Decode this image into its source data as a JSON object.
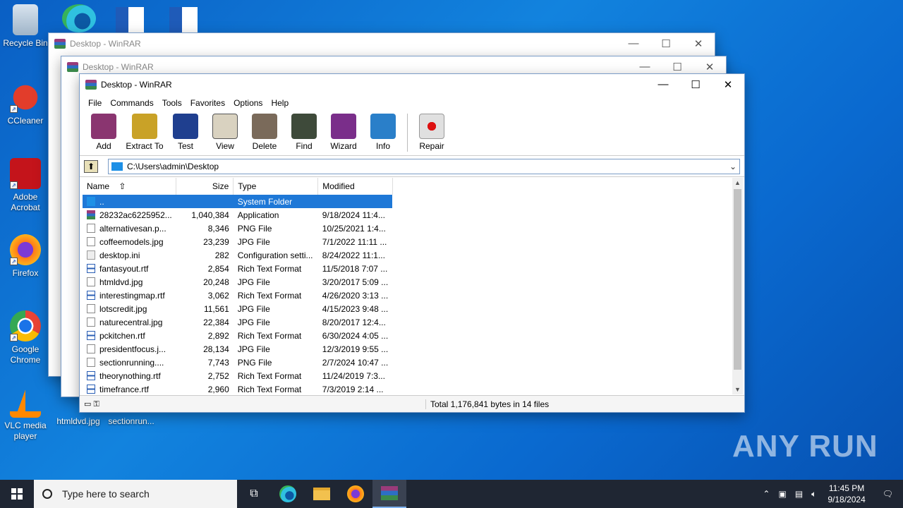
{
  "desktop": {
    "icons": [
      {
        "label": "Recycle Bin"
      },
      {
        "label": "CCleaner"
      },
      {
        "label": "Adobe Acrobat"
      },
      {
        "label": "Firefox"
      },
      {
        "label": "Google Chrome"
      },
      {
        "label": "VLC media player"
      },
      {
        "label": "htmldvd.jpg"
      },
      {
        "label": "sectionrun..."
      }
    ]
  },
  "back_windows": [
    {
      "title": "Desktop - WinRAR"
    },
    {
      "title": "Desktop - WinRAR"
    }
  ],
  "window": {
    "title": "Desktop - WinRAR",
    "controls": {
      "minimize": "—",
      "maximize": "☐",
      "close": "✕"
    },
    "menu": [
      "File",
      "Commands",
      "Tools",
      "Favorites",
      "Options",
      "Help"
    ],
    "toolbar": [
      {
        "label": "Add",
        "icon": "add-icon",
        "color": "#8a3570"
      },
      {
        "label": "Extract To",
        "icon": "extract-icon",
        "color": "#c9a227"
      },
      {
        "label": "Test",
        "icon": "test-icon",
        "color": "#1f3f8f"
      },
      {
        "label": "View",
        "icon": "view-icon",
        "color": "#d9d2c0"
      },
      {
        "label": "Delete",
        "icon": "delete-icon",
        "color": "#7a6a5a"
      },
      {
        "label": "Find",
        "icon": "find-icon",
        "color": "#3e4a3a"
      },
      {
        "label": "Wizard",
        "icon": "wizard-icon",
        "color": "#7a2e8a"
      },
      {
        "label": "Info",
        "icon": "info-icon",
        "color": "#2a7fc9"
      },
      {
        "label": "Repair",
        "icon": "repair-icon",
        "color": "#e0e0e0"
      }
    ],
    "address": "C:\\Users\\admin\\Desktop",
    "columns": {
      "name": "Name",
      "size": "Size",
      "type": "Type",
      "modified": "Modified"
    },
    "files": [
      {
        "name": "..",
        "size": "",
        "type": "System Folder",
        "modified": "",
        "kind": "up"
      },
      {
        "name": "28232ac6225952...",
        "size": "1,040,384",
        "type": "Application",
        "modified": "9/18/2024 11:4...",
        "kind": "exe"
      },
      {
        "name": "alternativesan.p...",
        "size": "8,346",
        "type": "PNG File",
        "modified": "10/25/2021 1:4...",
        "kind": "img"
      },
      {
        "name": "coffeemodels.jpg",
        "size": "23,239",
        "type": "JPG File",
        "modified": "7/1/2022 11:11 ...",
        "kind": "img"
      },
      {
        "name": "desktop.ini",
        "size": "282",
        "type": "Configuration setti...",
        "modified": "8/24/2022 11:1...",
        "kind": "ini"
      },
      {
        "name": "fantasyout.rtf",
        "size": "2,854",
        "type": "Rich Text Format",
        "modified": "11/5/2018 7:07 ...",
        "kind": "rtf"
      },
      {
        "name": "htmldvd.jpg",
        "size": "20,248",
        "type": "JPG File",
        "modified": "3/20/2017 5:09 ...",
        "kind": "img"
      },
      {
        "name": "interestingmap.rtf",
        "size": "3,062",
        "type": "Rich Text Format",
        "modified": "4/26/2020 3:13 ...",
        "kind": "rtf"
      },
      {
        "name": "lotscredit.jpg",
        "size": "11,561",
        "type": "JPG File",
        "modified": "4/15/2023 9:48 ...",
        "kind": "img"
      },
      {
        "name": "naturecentral.jpg",
        "size": "22,384",
        "type": "JPG File",
        "modified": "8/20/2017 12:4...",
        "kind": "img"
      },
      {
        "name": "pckitchen.rtf",
        "size": "2,892",
        "type": "Rich Text Format",
        "modified": "6/30/2024 4:05 ...",
        "kind": "rtf"
      },
      {
        "name": "presidentfocus.j...",
        "size": "28,134",
        "type": "JPG File",
        "modified": "12/3/2019 9:55 ...",
        "kind": "img"
      },
      {
        "name": "sectionrunning....",
        "size": "7,743",
        "type": "PNG File",
        "modified": "2/7/2024 10:47 ...",
        "kind": "img"
      },
      {
        "name": "theorynothing.rtf",
        "size": "2,752",
        "type": "Rich Text Format",
        "modified": "11/24/2019 7:3...",
        "kind": "rtf"
      },
      {
        "name": "timefrance.rtf",
        "size": "2,960",
        "type": "Rich Text Format",
        "modified": "7/3/2019 2:14 ...",
        "kind": "rtf"
      }
    ],
    "status": "Total 1,176,841 bytes in 14 files"
  },
  "taskbar": {
    "search_placeholder": "Type here to search",
    "time": "11:45 PM",
    "date": "9/18/2024"
  },
  "watermark": "ANY RUN"
}
